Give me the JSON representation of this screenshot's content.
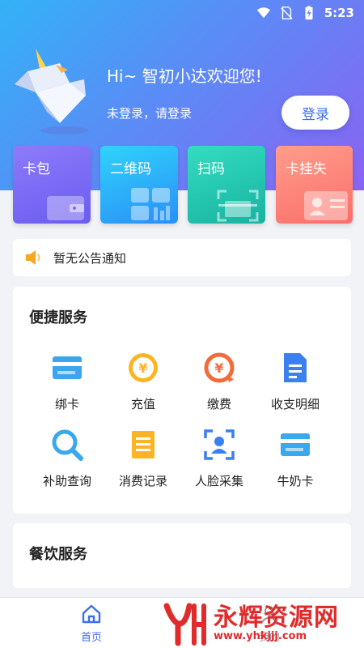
{
  "status_bar": {
    "time": "5:23"
  },
  "header": {
    "greeting": "Hi~ 智初小达欢迎您!",
    "login_hint": "未登录，请登录",
    "login_button": "登录"
  },
  "cards": [
    {
      "label": "卡包",
      "icon": "wallet-icon"
    },
    {
      "label": "二维码",
      "icon": "qr-code-icon"
    },
    {
      "label": "扫码",
      "icon": "scan-icon"
    },
    {
      "label": "卡挂失",
      "icon": "id-card-icon"
    }
  ],
  "notice": {
    "text": "暂无公告通知",
    "icon": "speaker-icon"
  },
  "services": {
    "title": "便捷服务",
    "items": [
      {
        "label": "绑卡",
        "icon": "bind-card-icon"
      },
      {
        "label": "充值",
        "icon": "recharge-yen-icon"
      },
      {
        "label": "缴费",
        "icon": "payment-yen-icon"
      },
      {
        "label": "收支明细",
        "icon": "document-icon"
      },
      {
        "label": "补助查询",
        "icon": "search-icon"
      },
      {
        "label": "消费记录",
        "icon": "record-list-icon"
      },
      {
        "label": "人脸采集",
        "icon": "face-scan-icon"
      },
      {
        "label": "牛奶卡",
        "icon": "milk-card-icon"
      }
    ]
  },
  "dining": {
    "title": "餐饮服务"
  },
  "bottom_nav": {
    "home": "首页",
    "second": "我的"
  },
  "watermark": {
    "text": "永辉资源网",
    "url": "www.yhkjjj.com"
  },
  "colors": {
    "accent": "#3b6ff0",
    "header_start": "#33b2f7",
    "header_end": "#8a63f2"
  }
}
